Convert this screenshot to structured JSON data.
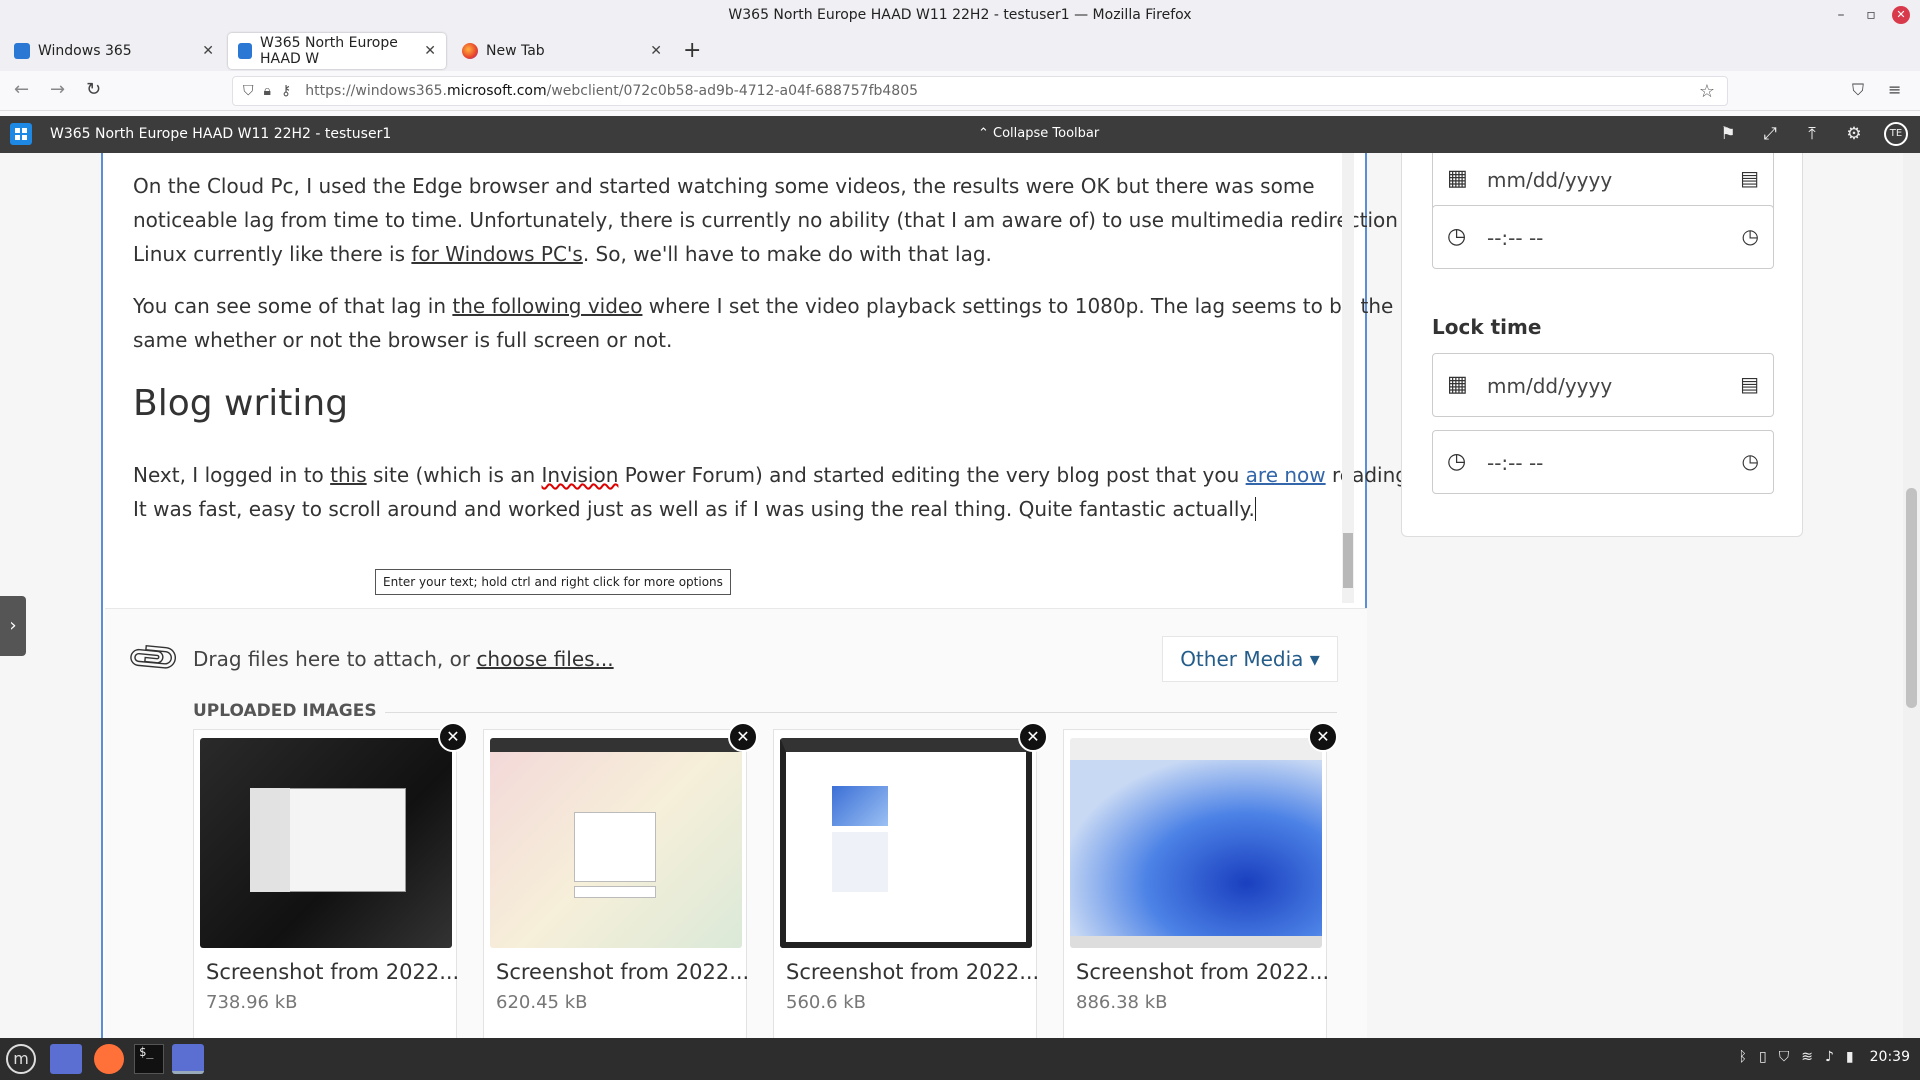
{
  "window": {
    "title": "W365 North Europe HAAD W11 22H2 - testuser1 — Mozilla Firefox",
    "controls": {
      "minimize": "–",
      "maximize": "▫",
      "close": "✕"
    }
  },
  "tabs": [
    {
      "label": "Windows 365",
      "close": "✕"
    },
    {
      "label": "W365 North Europe HAAD W",
      "close": "✕"
    },
    {
      "label": "New Tab",
      "close": "✕"
    }
  ],
  "newtab": "+",
  "nav": {
    "url_prefix": "https://windows365.",
    "url_domain": "microsoft.com",
    "url_path": "/webclient/072c0b58-ad9b-4712-a04f-688757fb4805"
  },
  "w365": {
    "title": "W365 North Europe HAAD W11 22H2 - testuser1",
    "collapse": "Collapse Toolbar",
    "avatar": "TE"
  },
  "article": {
    "p1_a": "On the Cloud Pc, I used the Edge browser and started watching some videos, the results were OK but there was some noticeable lag from time to time. Unfortunately, there is currently no ability (that I am aware of) to use multimedia redirection in Linux currently like there is ",
    "p1_link": "for Windows PC's",
    "p1_b": ". So, we'll have to make do with that lag.",
    "p2_a": "You can see some of that lag in ",
    "p2_link": "the following video",
    "p2_b": " where I set the video playback settings to 1080p. The lag seems to be the same whether or not the browser is full screen or not.",
    "heading": "Blog writing",
    "p3_a": "Next, I logged in to ",
    "p3_link": "this",
    "p3_b": " site (which is an ",
    "p3_invision": "Invision",
    "p3_c": " Power Forum) and started editing the very blog post that you ",
    "p3_link2": "are  now",
    "p3_d": " reading. It was fast, easy to scroll around and worked just as well as if I was using the real thing. Quite fantastic actually.",
    "tooltip": "Enter your text; hold ctrl and right click for more options"
  },
  "attach": {
    "drag_text": "Drag files here to attach, or ",
    "choose": "choose files...",
    "other_media": "Other Media ▾",
    "uploaded_heading": "UPLOADED IMAGES",
    "images": [
      {
        "name": "Screenshot from 2022...",
        "size": "738.96 kB"
      },
      {
        "name": "Screenshot from 2022...",
        "size": "620.45 kB"
      },
      {
        "name": "Screenshot from 2022...",
        "size": "560.6 kB"
      },
      {
        "name": "Screenshot from 2022...",
        "size": "886.38 kB"
      }
    ]
  },
  "side": {
    "date_placeholder": "mm/dd/yyyy",
    "time_placeholder": "--:-- --",
    "lock_time": "Lock time"
  },
  "taskbar": {
    "clock": "20:39",
    "term": "$_"
  }
}
